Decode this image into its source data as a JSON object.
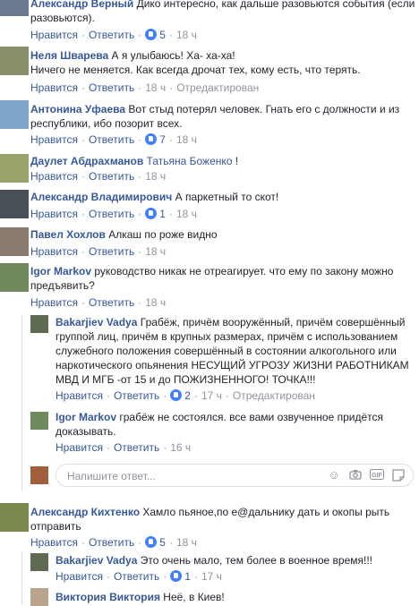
{
  "comments": [
    {
      "author": "Александр Верный",
      "text": "Дико интересно, как дальше разовьются события (если разовьются).",
      "like_label": "Нравится",
      "reply_label": "Ответить",
      "likes": "5",
      "time": "18 ч",
      "avatar_color": "#6b7a8f"
    },
    {
      "author": "Неля Шварева",
      "text": "А я улыбаюсь! Ха- ха-ха!",
      "text2": "Ничего не меняется. Как всегда дрочат тех, кому есть, что терять.",
      "like_label": "Нравится",
      "reply_label": "Ответить",
      "time": "18 ч",
      "edited": "Отредактирован",
      "avatar_color": "#8a8f6a"
    },
    {
      "author": "Антонина Уфаева",
      "text": "Вот стыд потерял человек. Гнать его с должности и из республики, ибо позорит всех.",
      "like_label": "Нравится",
      "reply_label": "Ответить",
      "likes": "7",
      "time": "18 ч",
      "avatar_color": "#7fa6c9"
    },
    {
      "author": "Даулет Абдрахманов",
      "tag": "Татьяна Боженко",
      "text": "!",
      "like_label": "Нравится",
      "reply_label": "Ответить",
      "time": "18 ч",
      "avatar_color": "#9aa36a"
    },
    {
      "author": "Александр Владимирович",
      "text": "А паркетный то скот!",
      "like_label": "Нравится",
      "reply_label": "Ответить",
      "likes": "1",
      "time": "18 ч",
      "avatar_color": "#4a5058"
    },
    {
      "author": "Павел Хохлов",
      "text": "Алкаш по роже видно",
      "like_label": "Нравится",
      "reply_label": "Ответить",
      "time": "18 ч",
      "avatar_color": "#8c7a6e"
    },
    {
      "author": "Igor Markov",
      "text": "руководство никак не отреагирует. что ему по закону можно предъявить?",
      "like_label": "Нравится",
      "reply_label": "Ответить",
      "time": "18 ч",
      "avatar_color": "#6f8a5a"
    },
    {
      "author": "Александр Кихтенко",
      "text": "Хамло пьяное,по е@дальнику дать и окопы рыть отправить",
      "like_label": "Нравится",
      "reply_label": "Ответить",
      "likes": "5",
      "time": "18 ч",
      "avatar_color": "#7a8a4e"
    }
  ],
  "replies": [
    {
      "author": "Bakarjiev Vadya",
      "text": "Грабёж, причём вооружённый, причём совершённый группой лиц, причём в крупных размерах, причём с использованием служебного положения совершённый в состоянии алкогольного или наркотического опьянения НЕСУЩИЙ УГРОЗУ ЖИЗНИ РАБОТНИКАМ МВД И МГБ -от 15 и до ПОЖИЗНЕННОГО! ТОЧКА!!!",
      "like_label": "Нравится",
      "reply_label": "Ответить",
      "likes": "2",
      "time": "17 ч",
      "edited": "Отредактирован",
      "avatar_color": "#5e6b52"
    },
    {
      "author": "Igor Markov",
      "text": "грабёж не состоялся. все вами озвученное придётся доказывать.",
      "like_label": "Нравится",
      "reply_label": "Ответить",
      "time": "16 ч",
      "avatar_color": "#6f8a5a"
    },
    {
      "author": "Bakarjiev Vadya",
      "text": "Это очень мало, тем более в военное время!!!",
      "like_label": "Нравится",
      "reply_label": "Ответить",
      "likes": "1",
      "time": "17 ч",
      "avatar_color": "#5e6b52"
    },
    {
      "author": "Виктория Виктория",
      "text": "Неё, в Киев!",
      "avatar_color": "#b9a58c"
    }
  ],
  "reply_box": {
    "placeholder": "Напишите ответ...",
    "avatar_color": "#a0603c",
    "icons": [
      "emoji-icon",
      "camera-icon",
      "gif-icon",
      "sticker-icon"
    ]
  }
}
